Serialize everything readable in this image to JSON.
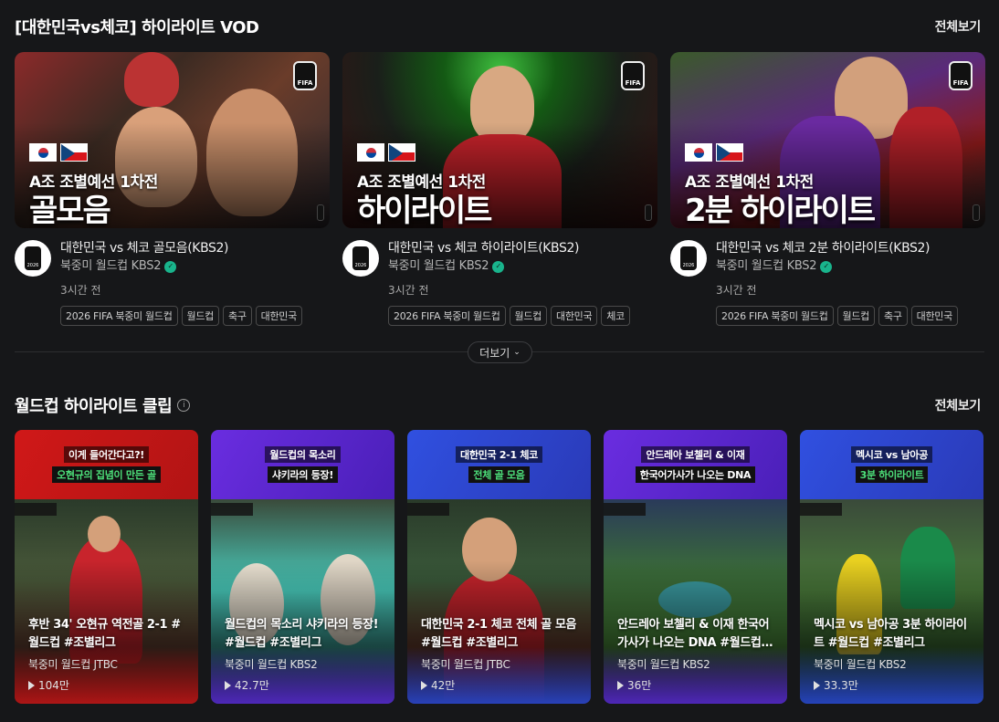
{
  "vod_section": {
    "title": "[대한민국vs체코] 하이라이트 VOD",
    "see_all": "전체보기",
    "items": [
      {
        "thumb_sub": "A조 조별예선 1차전",
        "thumb_big": "골모음",
        "title": "대한민국 vs 체코 골모음(KBS2)",
        "channel": "북중미 월드컵 KBS2",
        "time": "3시간 전",
        "tags": [
          "2026 FIFA 북중미 월드컵",
          "월드컵",
          "축구",
          "대한민국"
        ]
      },
      {
        "thumb_sub": "A조 조별예선 1차전",
        "thumb_big": "하이라이트",
        "title": "대한민국 vs 체코 하이라이트(KBS2)",
        "channel": "북중미 월드컵 KBS2",
        "time": "3시간 전",
        "tags": [
          "2026 FIFA 북중미 월드컵",
          "월드컵",
          "대한민국",
          "체코"
        ]
      },
      {
        "thumb_sub": "A조 조별예선 1차전",
        "thumb_big": "2분 하이라이트",
        "title": "대한민국 vs 체코 2분 하이라이트(KBS2)",
        "channel": "북중미 월드컵 KBS2",
        "time": "3시간 전",
        "tags": [
          "2026 FIFA 북중미 월드컵",
          "월드컵",
          "축구",
          "대한민국"
        ]
      }
    ],
    "more_label": "더보기"
  },
  "clip_section": {
    "title": "월드컵 하이라이트 클립",
    "see_all": "전체보기",
    "items": [
      {
        "hl1": "이게 들어간다고?!",
        "hl2": "오현규의 집념이 만든 골",
        "title": "후반 34' 오현규 역전골 2-1 #월드컵 #조별리그",
        "channel": "북중미 월드컵 JTBC",
        "views": "104만"
      },
      {
        "hl1": "월드컵의 목소리",
        "hl2": "샤키라의 등장!",
        "title": "월드컵의 목소리 샤키라의 등장! #월드컵 #조별리그",
        "channel": "북중미 월드컵 KBS2",
        "views": "42.7만"
      },
      {
        "hl1": "대한민국 2-1 체코",
        "hl2": "전체 골 모음",
        "title": "대한민국 2-1 체코 전체 골 모음 #월드컵 #조별리그",
        "channel": "북중미 월드컵 JTBC",
        "views": "42만"
      },
      {
        "hl1": "안드레아 보첼리 & 이재",
        "hl2": "한국어가사가 나오는 DNA",
        "title": "안드레아 보첼리 & 이재 한국어가사가 나오는 DNA #월드컵 #조별리그",
        "channel": "북중미 월드컵 KBS2",
        "views": "36만"
      },
      {
        "hl1": "멕시코 vs 남아공",
        "hl2": "3분 하이라이트",
        "title": "멕시코 vs 남아공 3분 하이라이트 #월드컵 #조별리그",
        "channel": "북중미 월드컵 KBS2",
        "views": "33.3만"
      }
    ]
  },
  "colors": {
    "background": "#161719",
    "verified": "#19b48c",
    "clip1_top": "#c81818",
    "clip2_top": "#5a2bd6",
    "clip3_top": "#2a4bd8",
    "clip4_top": "#5a2bd6",
    "clip5_top": "#2a4bd8"
  }
}
